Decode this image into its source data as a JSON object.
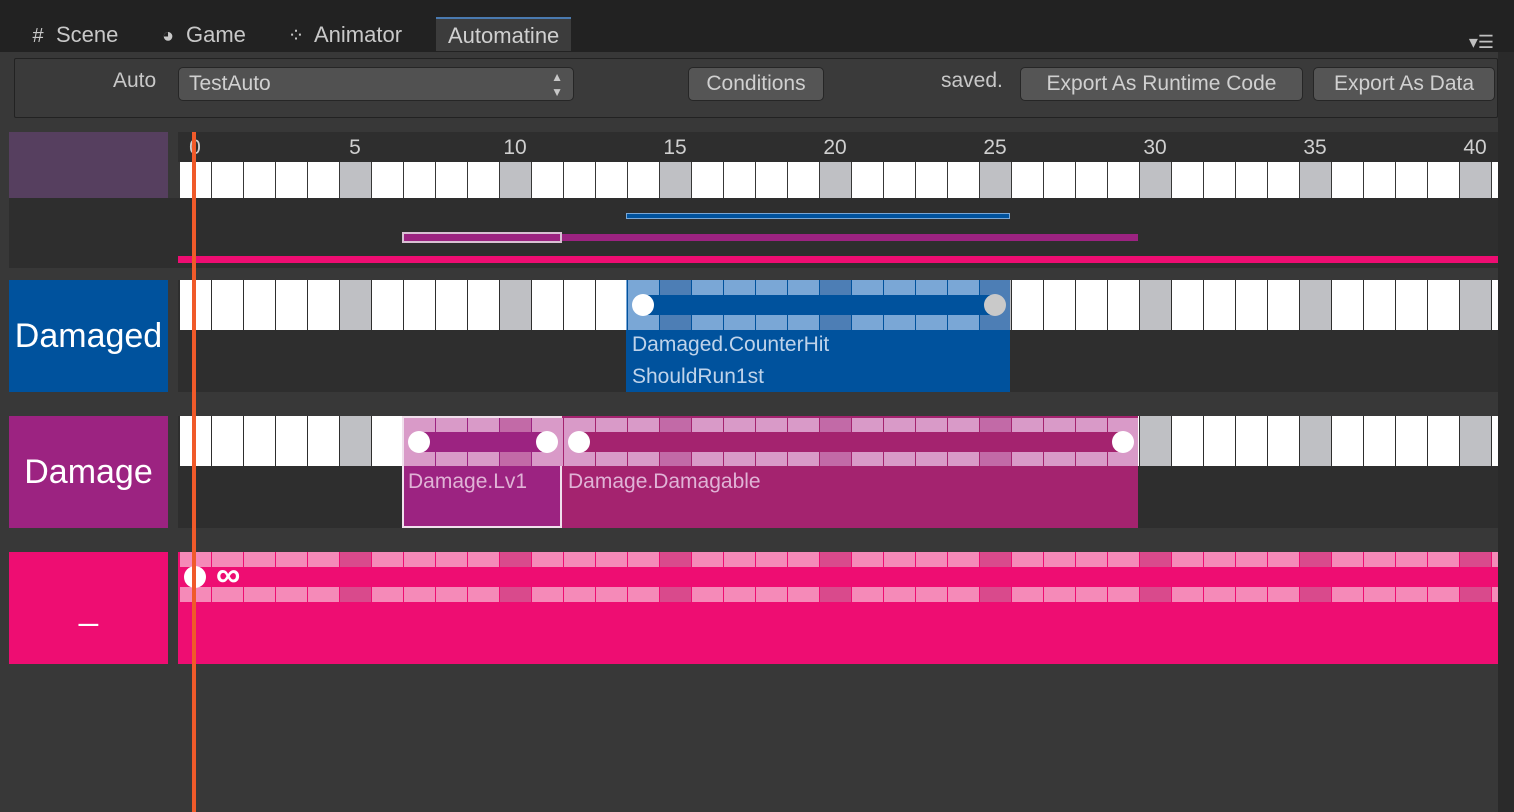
{
  "tabs": [
    {
      "label": "Scene",
      "icon": "scene-grid-icon"
    },
    {
      "label": "Game",
      "icon": "pacman-icon"
    },
    {
      "label": "Animator",
      "icon": "animator-icon"
    },
    {
      "label": "Automatine",
      "icon": ""
    }
  ],
  "active_tab": "Automatine",
  "toolbar": {
    "auto_label": "Auto",
    "auto_value": "TestAuto",
    "conditions_label": "Conditions",
    "status_text": "saved.",
    "export_code_label": "Export As Runtime Code",
    "export_data_label": "Export As Data"
  },
  "timeline": {
    "ticks": [
      "0",
      "5",
      "10",
      "15",
      "20",
      "25",
      "30",
      "35",
      "40"
    ],
    "playhead_frame": 0,
    "colors": {
      "header": "#563f5f",
      "damaged": "#00529d",
      "damage": "#9c2381",
      "infinite": "#ee0d72",
      "playhead": "#f05a2a"
    }
  },
  "timelines": [
    {
      "label": "Damaged",
      "tacks": [
        {
          "title": "Damaged.CounterHit",
          "subtitle": "ShouldRun1st",
          "start": 14,
          "span": 12
        }
      ]
    },
    {
      "label": "Damage",
      "tacks": [
        {
          "title": "Damage.Lv1",
          "start": 7,
          "span": 5
        },
        {
          "title": "Damage.Damagable",
          "start": 12,
          "span": 18
        }
      ]
    },
    {
      "label": "_",
      "tacks": [
        {
          "title": "",
          "start": 0,
          "span": "infinite",
          "infinity_symbol": "∞"
        }
      ]
    }
  ]
}
